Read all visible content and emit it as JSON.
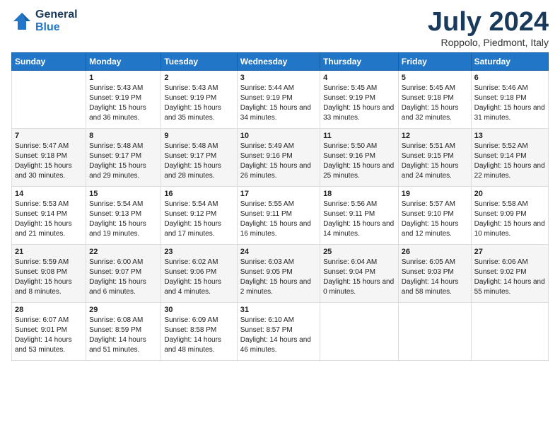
{
  "header": {
    "logo_line1": "General",
    "logo_line2": "Blue",
    "month": "July 2024",
    "location": "Roppolo, Piedmont, Italy"
  },
  "weekdays": [
    "Sunday",
    "Monday",
    "Tuesday",
    "Wednesday",
    "Thursday",
    "Friday",
    "Saturday"
  ],
  "weeks": [
    [
      {
        "day": "",
        "sunrise": "",
        "sunset": "",
        "daylight": ""
      },
      {
        "day": "1",
        "sunrise": "Sunrise: 5:43 AM",
        "sunset": "Sunset: 9:19 PM",
        "daylight": "Daylight: 15 hours and 36 minutes."
      },
      {
        "day": "2",
        "sunrise": "Sunrise: 5:43 AM",
        "sunset": "Sunset: 9:19 PM",
        "daylight": "Daylight: 15 hours and 35 minutes."
      },
      {
        "day": "3",
        "sunrise": "Sunrise: 5:44 AM",
        "sunset": "Sunset: 9:19 PM",
        "daylight": "Daylight: 15 hours and 34 minutes."
      },
      {
        "day": "4",
        "sunrise": "Sunrise: 5:45 AM",
        "sunset": "Sunset: 9:19 PM",
        "daylight": "Daylight: 15 hours and 33 minutes."
      },
      {
        "day": "5",
        "sunrise": "Sunrise: 5:45 AM",
        "sunset": "Sunset: 9:18 PM",
        "daylight": "Daylight: 15 hours and 32 minutes."
      },
      {
        "day": "6",
        "sunrise": "Sunrise: 5:46 AM",
        "sunset": "Sunset: 9:18 PM",
        "daylight": "Daylight: 15 hours and 31 minutes."
      }
    ],
    [
      {
        "day": "7",
        "sunrise": "Sunrise: 5:47 AM",
        "sunset": "Sunset: 9:18 PM",
        "daylight": "Daylight: 15 hours and 30 minutes."
      },
      {
        "day": "8",
        "sunrise": "Sunrise: 5:48 AM",
        "sunset": "Sunset: 9:17 PM",
        "daylight": "Daylight: 15 hours and 29 minutes."
      },
      {
        "day": "9",
        "sunrise": "Sunrise: 5:48 AM",
        "sunset": "Sunset: 9:17 PM",
        "daylight": "Daylight: 15 hours and 28 minutes."
      },
      {
        "day": "10",
        "sunrise": "Sunrise: 5:49 AM",
        "sunset": "Sunset: 9:16 PM",
        "daylight": "Daylight: 15 hours and 26 minutes."
      },
      {
        "day": "11",
        "sunrise": "Sunrise: 5:50 AM",
        "sunset": "Sunset: 9:16 PM",
        "daylight": "Daylight: 15 hours and 25 minutes."
      },
      {
        "day": "12",
        "sunrise": "Sunrise: 5:51 AM",
        "sunset": "Sunset: 9:15 PM",
        "daylight": "Daylight: 15 hours and 24 minutes."
      },
      {
        "day": "13",
        "sunrise": "Sunrise: 5:52 AM",
        "sunset": "Sunset: 9:14 PM",
        "daylight": "Daylight: 15 hours and 22 minutes."
      }
    ],
    [
      {
        "day": "14",
        "sunrise": "Sunrise: 5:53 AM",
        "sunset": "Sunset: 9:14 PM",
        "daylight": "Daylight: 15 hours and 21 minutes."
      },
      {
        "day": "15",
        "sunrise": "Sunrise: 5:54 AM",
        "sunset": "Sunset: 9:13 PM",
        "daylight": "Daylight: 15 hours and 19 minutes."
      },
      {
        "day": "16",
        "sunrise": "Sunrise: 5:54 AM",
        "sunset": "Sunset: 9:12 PM",
        "daylight": "Daylight: 15 hours and 17 minutes."
      },
      {
        "day": "17",
        "sunrise": "Sunrise: 5:55 AM",
        "sunset": "Sunset: 9:11 PM",
        "daylight": "Daylight: 15 hours and 16 minutes."
      },
      {
        "day": "18",
        "sunrise": "Sunrise: 5:56 AM",
        "sunset": "Sunset: 9:11 PM",
        "daylight": "Daylight: 15 hours and 14 minutes."
      },
      {
        "day": "19",
        "sunrise": "Sunrise: 5:57 AM",
        "sunset": "Sunset: 9:10 PM",
        "daylight": "Daylight: 15 hours and 12 minutes."
      },
      {
        "day": "20",
        "sunrise": "Sunrise: 5:58 AM",
        "sunset": "Sunset: 9:09 PM",
        "daylight": "Daylight: 15 hours and 10 minutes."
      }
    ],
    [
      {
        "day": "21",
        "sunrise": "Sunrise: 5:59 AM",
        "sunset": "Sunset: 9:08 PM",
        "daylight": "Daylight: 15 hours and 8 minutes."
      },
      {
        "day": "22",
        "sunrise": "Sunrise: 6:00 AM",
        "sunset": "Sunset: 9:07 PM",
        "daylight": "Daylight: 15 hours and 6 minutes."
      },
      {
        "day": "23",
        "sunrise": "Sunrise: 6:02 AM",
        "sunset": "Sunset: 9:06 PM",
        "daylight": "Daylight: 15 hours and 4 minutes."
      },
      {
        "day": "24",
        "sunrise": "Sunrise: 6:03 AM",
        "sunset": "Sunset: 9:05 PM",
        "daylight": "Daylight: 15 hours and 2 minutes."
      },
      {
        "day": "25",
        "sunrise": "Sunrise: 6:04 AM",
        "sunset": "Sunset: 9:04 PM",
        "daylight": "Daylight: 15 hours and 0 minutes."
      },
      {
        "day": "26",
        "sunrise": "Sunrise: 6:05 AM",
        "sunset": "Sunset: 9:03 PM",
        "daylight": "Daylight: 14 hours and 58 minutes."
      },
      {
        "day": "27",
        "sunrise": "Sunrise: 6:06 AM",
        "sunset": "Sunset: 9:02 PM",
        "daylight": "Daylight: 14 hours and 55 minutes."
      }
    ],
    [
      {
        "day": "28",
        "sunrise": "Sunrise: 6:07 AM",
        "sunset": "Sunset: 9:01 PM",
        "daylight": "Daylight: 14 hours and 53 minutes."
      },
      {
        "day": "29",
        "sunrise": "Sunrise: 6:08 AM",
        "sunset": "Sunset: 8:59 PM",
        "daylight": "Daylight: 14 hours and 51 minutes."
      },
      {
        "day": "30",
        "sunrise": "Sunrise: 6:09 AM",
        "sunset": "Sunset: 8:58 PM",
        "daylight": "Daylight: 14 hours and 48 minutes."
      },
      {
        "day": "31",
        "sunrise": "Sunrise: 6:10 AM",
        "sunset": "Sunset: 8:57 PM",
        "daylight": "Daylight: 14 hours and 46 minutes."
      },
      {
        "day": "",
        "sunrise": "",
        "sunset": "",
        "daylight": ""
      },
      {
        "day": "",
        "sunrise": "",
        "sunset": "",
        "daylight": ""
      },
      {
        "day": "",
        "sunrise": "",
        "sunset": "",
        "daylight": ""
      }
    ]
  ]
}
